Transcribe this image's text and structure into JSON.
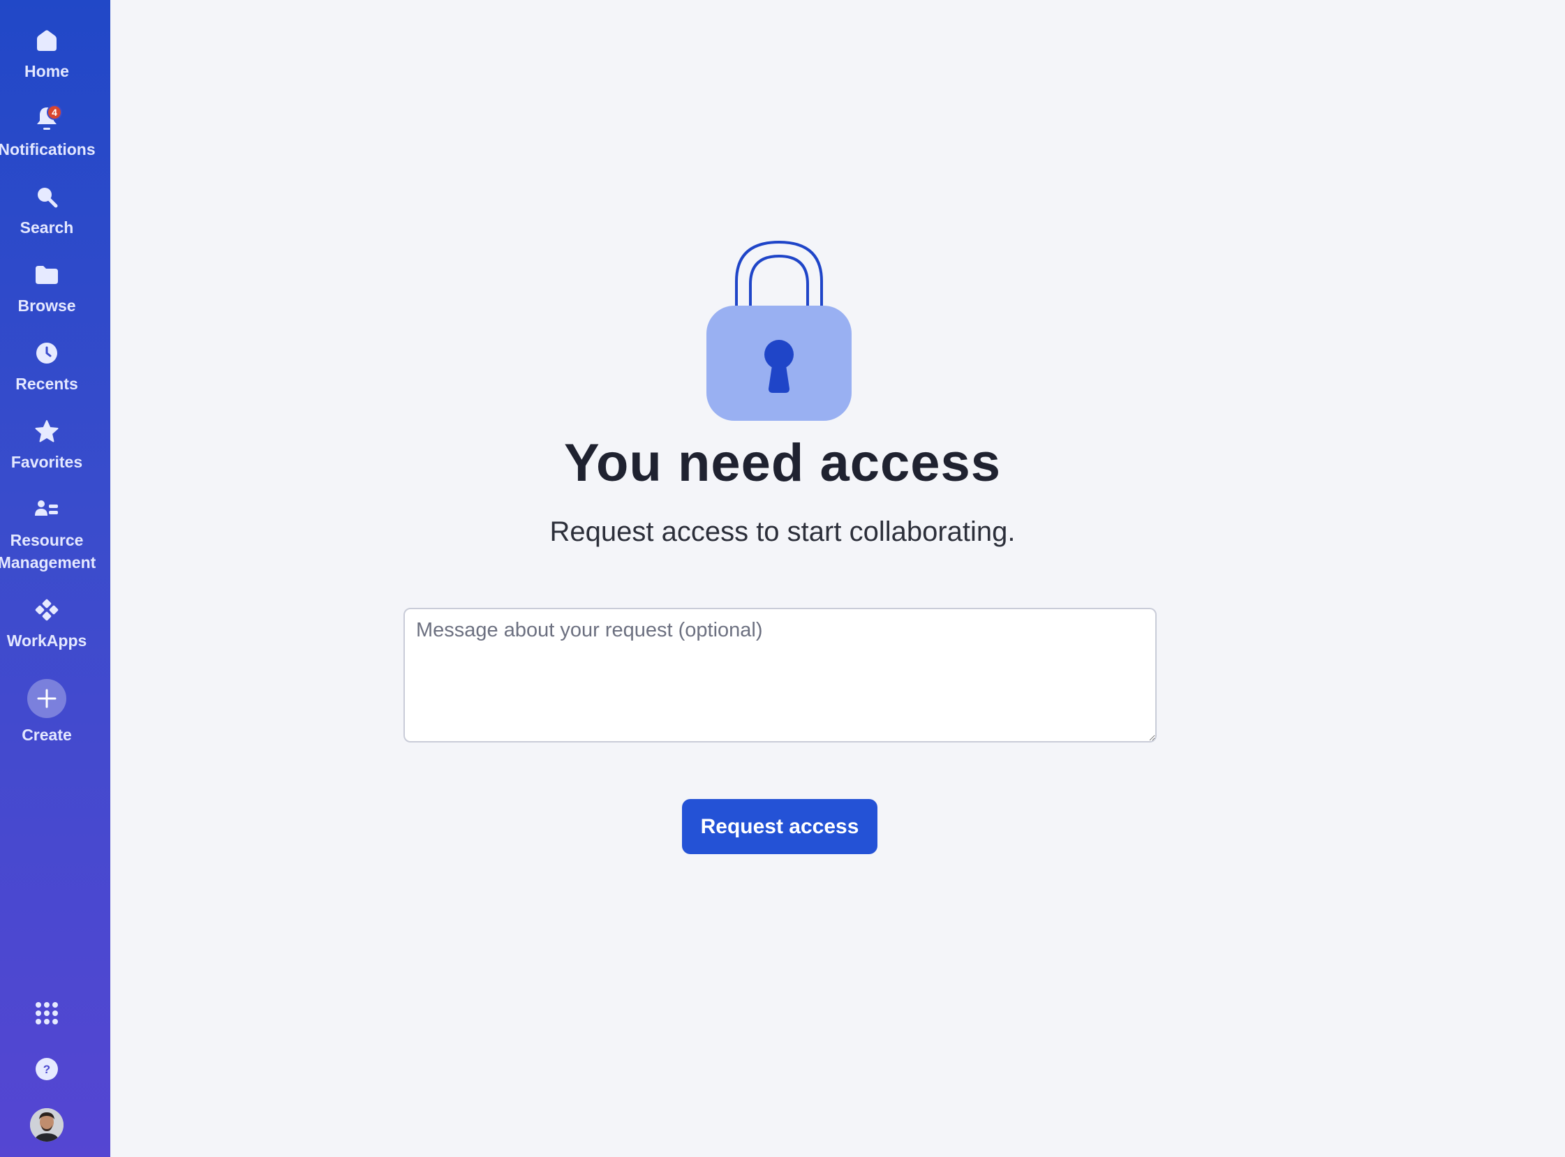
{
  "sidebar": {
    "items": [
      {
        "label": "Home",
        "icon": "home-icon"
      },
      {
        "label": "Notifications",
        "icon": "bell-icon",
        "badge": "4"
      },
      {
        "label": "Search",
        "icon": "search-icon"
      },
      {
        "label": "Browse",
        "icon": "folder-icon"
      },
      {
        "label": "Recents",
        "icon": "clock-icon"
      },
      {
        "label": "Favorites",
        "icon": "star-icon"
      },
      {
        "label": "Resource Management",
        "icon": "people-icon"
      },
      {
        "label": "WorkApps",
        "icon": "workapps-icon"
      },
      {
        "label": "Create",
        "icon": "plus-icon"
      }
    ],
    "bottom": {
      "apps_icon": "grid-icon",
      "help_icon": "help-icon",
      "help_glyph": "?",
      "avatar": "user-avatar"
    },
    "colors": {
      "gradient_top": "#2148c7",
      "gradient_bottom": "#5546d2",
      "badge": "#d8462f"
    }
  },
  "main": {
    "icon": "lock-icon",
    "title": "You need access",
    "subtitle": "Request access to start collaborating.",
    "message_placeholder": "Message about your request (optional)",
    "message_value": "",
    "button_label": "Request access",
    "colors": {
      "accent": "#2452d6",
      "lock_body": "#99b0f2",
      "lock_dark": "#1f45c8",
      "background": "#f4f5f9"
    }
  }
}
